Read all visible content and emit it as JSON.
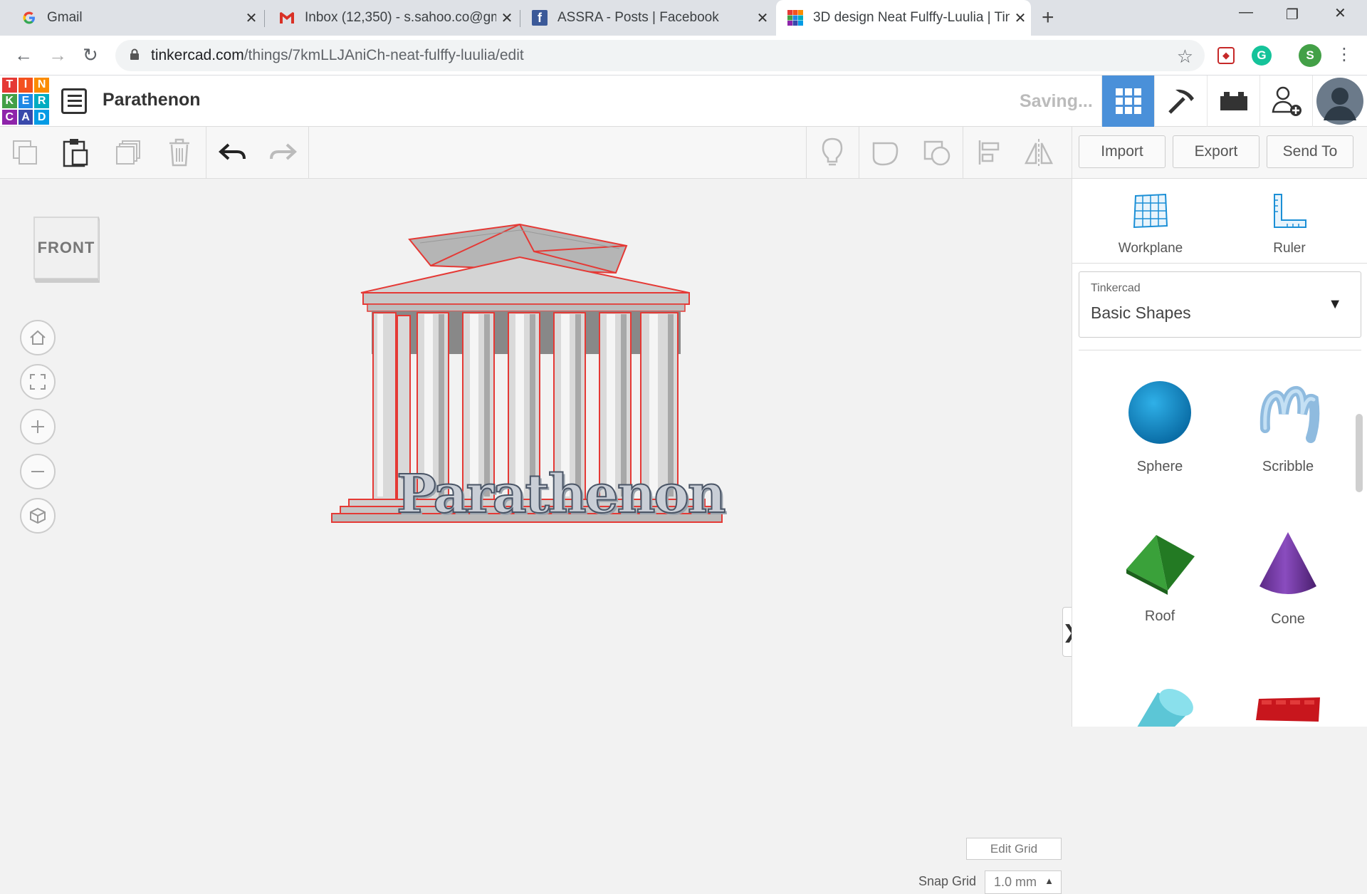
{
  "browser": {
    "tabs": [
      {
        "title": "Gmail",
        "icon": "google-icon"
      },
      {
        "title": "Inbox (12,350) - s.sahoo.co@gma",
        "icon": "gmail-icon"
      },
      {
        "title": "ASSRA - Posts | Facebook",
        "icon": "facebook-icon"
      },
      {
        "title": "3D design Neat Fulffy-Luulia | Tin",
        "icon": "tinkercad-icon",
        "active": true
      }
    ],
    "new_tab": "+",
    "url_host": "tinkercad.com",
    "url_path": "/things/7kmLLJAniCh-neat-fulffy-luulia/edit",
    "profile_initial": "S"
  },
  "app": {
    "logo_letters": [
      "T",
      "I",
      "N",
      "K",
      "E",
      "R",
      "C",
      "A",
      "D"
    ],
    "logo_colors": [
      "#e53935",
      "#f4511e",
      "#fb8c00",
      "#43a047",
      "#1e88e5",
      "#00acc1",
      "#8e24aa",
      "#3949ab",
      "#039be5"
    ],
    "design_title": "Parathenon",
    "status": "Saving...",
    "accent": "#4a90d9"
  },
  "toolbar": {
    "import_label": "Import",
    "export_label": "Export",
    "send_to_label": "Send To"
  },
  "workspace": {
    "view_cube_label": "FRONT",
    "model_text": "Parathenon",
    "edit_grid_label": "Edit Grid",
    "snap_grid_label": "Snap Grid",
    "snap_grid_value": "1.0 mm"
  },
  "sidebar": {
    "workplane_label": "Workplane",
    "ruler_label": "Ruler",
    "library_source": "Tinkercad",
    "library_name": "Basic Shapes",
    "shapes": [
      "Sphere",
      "Scribble",
      "Roof",
      "Cone"
    ]
  }
}
